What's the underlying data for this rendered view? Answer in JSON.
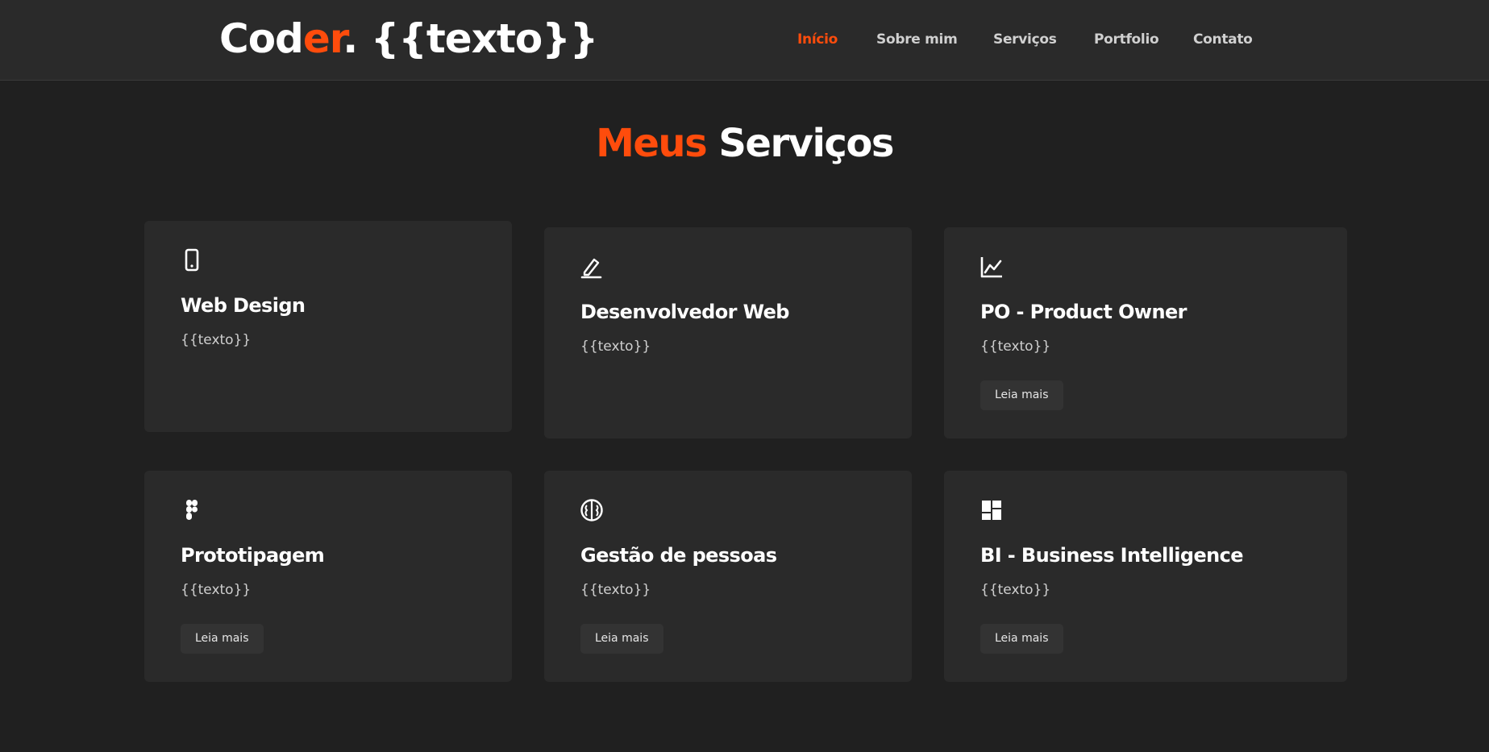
{
  "header": {
    "logo": {
      "part1": "Cod",
      "part2": "er",
      "part3": ". {{texto}}"
    },
    "nav": [
      {
        "label": "Início",
        "active": true
      },
      {
        "label": "Sobre mim",
        "active": false
      },
      {
        "label": "Serviços",
        "active": false
      },
      {
        "label": "Portfolio",
        "active": false
      },
      {
        "label": "Contato",
        "active": false
      }
    ]
  },
  "services": {
    "title_accent": "Meus",
    "title_rest": "Serviços",
    "cards": [
      {
        "icon": "mobile-icon",
        "title": "Web Design",
        "text": "{{texto}}",
        "button": ""
      },
      {
        "icon": "pencil-icon",
        "title": "Desenvolvedor Web",
        "text": "{{texto}}",
        "button": ""
      },
      {
        "icon": "chart-line-icon",
        "title": "PO - Product Owner",
        "text": "{{texto}}",
        "button": "Leia mais"
      },
      {
        "icon": "figma-icon",
        "title": "Prototipagem",
        "text": "{{texto}}",
        "button": "Leia mais"
      },
      {
        "icon": "brain-icon",
        "title": "Gestão de pessoas",
        "text": "{{texto}}",
        "button": "Leia mais"
      },
      {
        "icon": "dashboard-icon",
        "title": "BI - Business Intelligence",
        "text": "{{texto}}",
        "button": "Leia mais"
      }
    ]
  },
  "colors": {
    "accent": "#ff4c0c",
    "background": "#202020",
    "header_bg": "#2a2a2a",
    "card_bg": "#2a2a2a",
    "button_bg": "#333333"
  }
}
